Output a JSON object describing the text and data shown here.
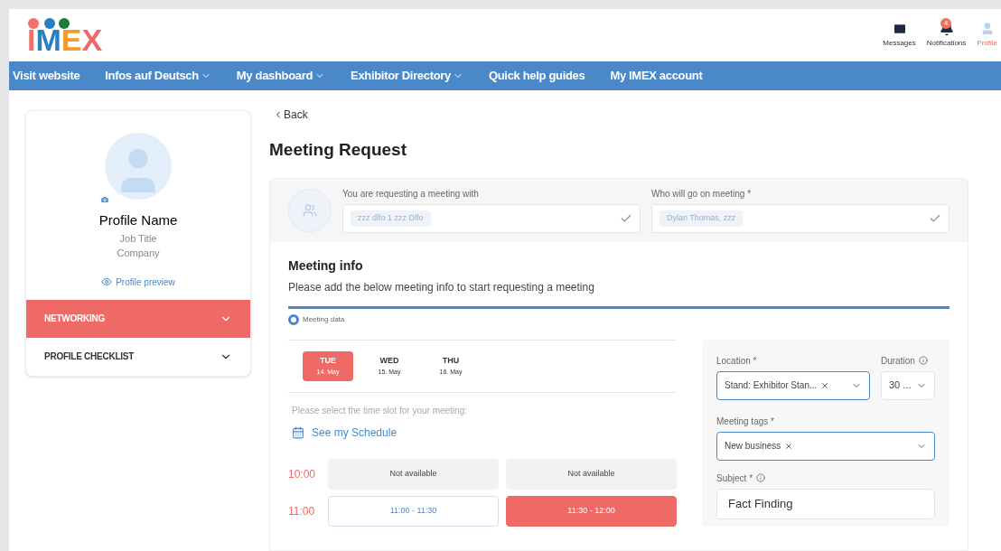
{
  "logo": {
    "letters": [
      {
        "char": "I",
        "color": "#f0706e"
      },
      {
        "char": "M",
        "color": "#2a7fc0"
      },
      {
        "char": "E",
        "color": "#f39c2e"
      },
      {
        "char": "X",
        "color": "#ef6a66"
      }
    ]
  },
  "header_actions": [
    {
      "kind": "messages",
      "label": "Messages"
    },
    {
      "kind": "notifications",
      "label": "Notifications",
      "badge": "4"
    },
    {
      "kind": "profile",
      "label": "Profile"
    }
  ],
  "nav": [
    {
      "label": "Visit website",
      "dropdown": false
    },
    {
      "label": "Infos auf Deutsch",
      "dropdown": true
    },
    {
      "label": "My dashboard",
      "dropdown": true
    },
    {
      "label": "Exhibitor Directory",
      "dropdown": true
    },
    {
      "label": "Quick help guides",
      "dropdown": false
    },
    {
      "label": "My IMEX account",
      "dropdown": false
    }
  ],
  "profile": {
    "name": "Profile Name",
    "job_title": "Job Title",
    "company": "Company",
    "preview_link": "Profile preview"
  },
  "sidebar_sections": [
    {
      "label": "NETWORKING",
      "selected": true
    },
    {
      "label": "PROFILE CHECKLIST",
      "selected": false
    }
  ],
  "back_link": "Back",
  "page_title": "Meeting Request",
  "participants": [
    {
      "label": "You are requesting a meeting with",
      "value": "zzz dlfo 1 zzz Dlfo"
    },
    {
      "label": "Who will go on meeting *",
      "value": "Dylan Thomas, zzz"
    }
  ],
  "meeting_info": {
    "title": "Meeting info",
    "subtitle": "Please add the below meeting info to start requesting a meeting",
    "step": "Meeting data"
  },
  "days": [
    {
      "weekday": "TUE",
      "date": "14. May",
      "selected": true
    },
    {
      "weekday": "WED",
      "date": "15. May",
      "selected": false
    },
    {
      "weekday": "THU",
      "date": "16. May",
      "selected": false
    }
  ],
  "slot_prompt": "Please select the time slot for your meeting:",
  "schedule_link": "See my Schedule",
  "time_rows": [
    {
      "hour": "10:00",
      "slots": [
        {
          "label": "Not available",
          "kind": "unavailable",
          "selected": false
        },
        {
          "label": "Not available",
          "kind": "unavailable",
          "selected": false
        }
      ]
    },
    {
      "hour": "11:00",
      "slots": [
        {
          "label": "11:00 - 11:30",
          "kind": "available",
          "selected": false
        },
        {
          "label": "11:30 - 12:00",
          "kind": "available",
          "selected": true
        }
      ]
    }
  ],
  "form": {
    "location": {
      "label": "Location *",
      "value": "Stand: Exhibitor Stan..."
    },
    "duration": {
      "label": "Duration",
      "value": "30 ..."
    },
    "tags": {
      "label": "Meeting tags *",
      "value": "New business"
    },
    "subject": {
      "label": "Subject *",
      "value": "Fact Finding"
    }
  }
}
